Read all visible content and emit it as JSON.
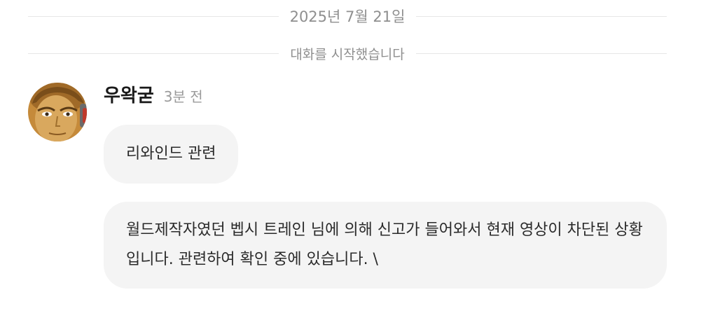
{
  "conversation": {
    "date_divider": "2025년 7월 21일",
    "start_divider": "대화를 시작했습니다"
  },
  "message": {
    "sender": "우왁굳",
    "time": "3분 전",
    "avatar_icon": "user-avatar-portrait",
    "bubbles": [
      "리와인드 관련",
      "월드제작자였던 벱시 트레인 님에 의해 신고가 들어와서 현재 영상이 차단된 상황입니다. 관련하여 확인 중에 있습니다. \\"
    ]
  },
  "colors": {
    "divider_line": "#e6e6e6",
    "divider_text": "#8f8f8f",
    "bubble_bg": "#f4f4f4",
    "time_text": "#9a9a9a"
  }
}
